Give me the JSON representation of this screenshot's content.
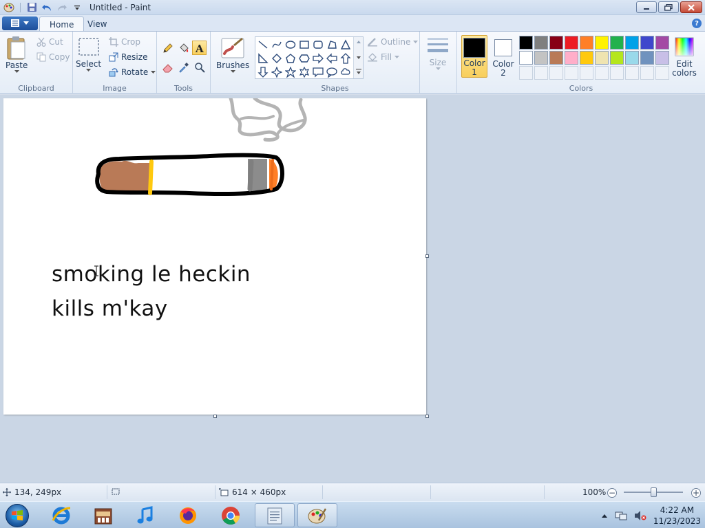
{
  "window": {
    "title": "Untitled - Paint"
  },
  "tabs": [
    {
      "label": "Home"
    },
    {
      "label": "View"
    }
  ],
  "ribbon": {
    "clipboard": {
      "group_label": "Clipboard",
      "paste": "Paste",
      "cut": "Cut",
      "copy": "Copy"
    },
    "image": {
      "group_label": "Image",
      "select": "Select",
      "crop": "Crop",
      "resize": "Resize",
      "rotate": "Rotate"
    },
    "tools": {
      "group_label": "Tools"
    },
    "brushes": {
      "label": "Brushes"
    },
    "shapes": {
      "group_label": "Shapes",
      "outline": "Outline",
      "fill": "Fill"
    },
    "size": {
      "label": "Size"
    },
    "colors": {
      "group_label": "Colors",
      "color1_line1": "Color",
      "color1_line2": "1",
      "color2_line1": "Color",
      "color2_line2": "2",
      "edit_line1": "Edit",
      "edit_line2": "colors",
      "color1_value": "#000000",
      "color2_value": "#ffffff",
      "palette": [
        "#000000",
        "#7f7f7f",
        "#880015",
        "#ed1c24",
        "#ff7f27",
        "#fff200",
        "#22b14c",
        "#00a2e8",
        "#3f48cc",
        "#a349a4",
        "#ffffff",
        "#c3c3c3",
        "#b97a57",
        "#ffaec9",
        "#ffc90e",
        "#efe4b0",
        "#b5e61d",
        "#99d9ea",
        "#7092be",
        "#c8bfe7"
      ]
    }
  },
  "canvas": {
    "text_line1": "smoking le heckin",
    "text_line2": "kills m'kay"
  },
  "status": {
    "cursor_pos": "134, 249px",
    "canvas_size": "614 × 460px",
    "zoom": "100%"
  },
  "taskbar": {
    "time": "4:22 AM",
    "date": "11/23/2023"
  }
}
